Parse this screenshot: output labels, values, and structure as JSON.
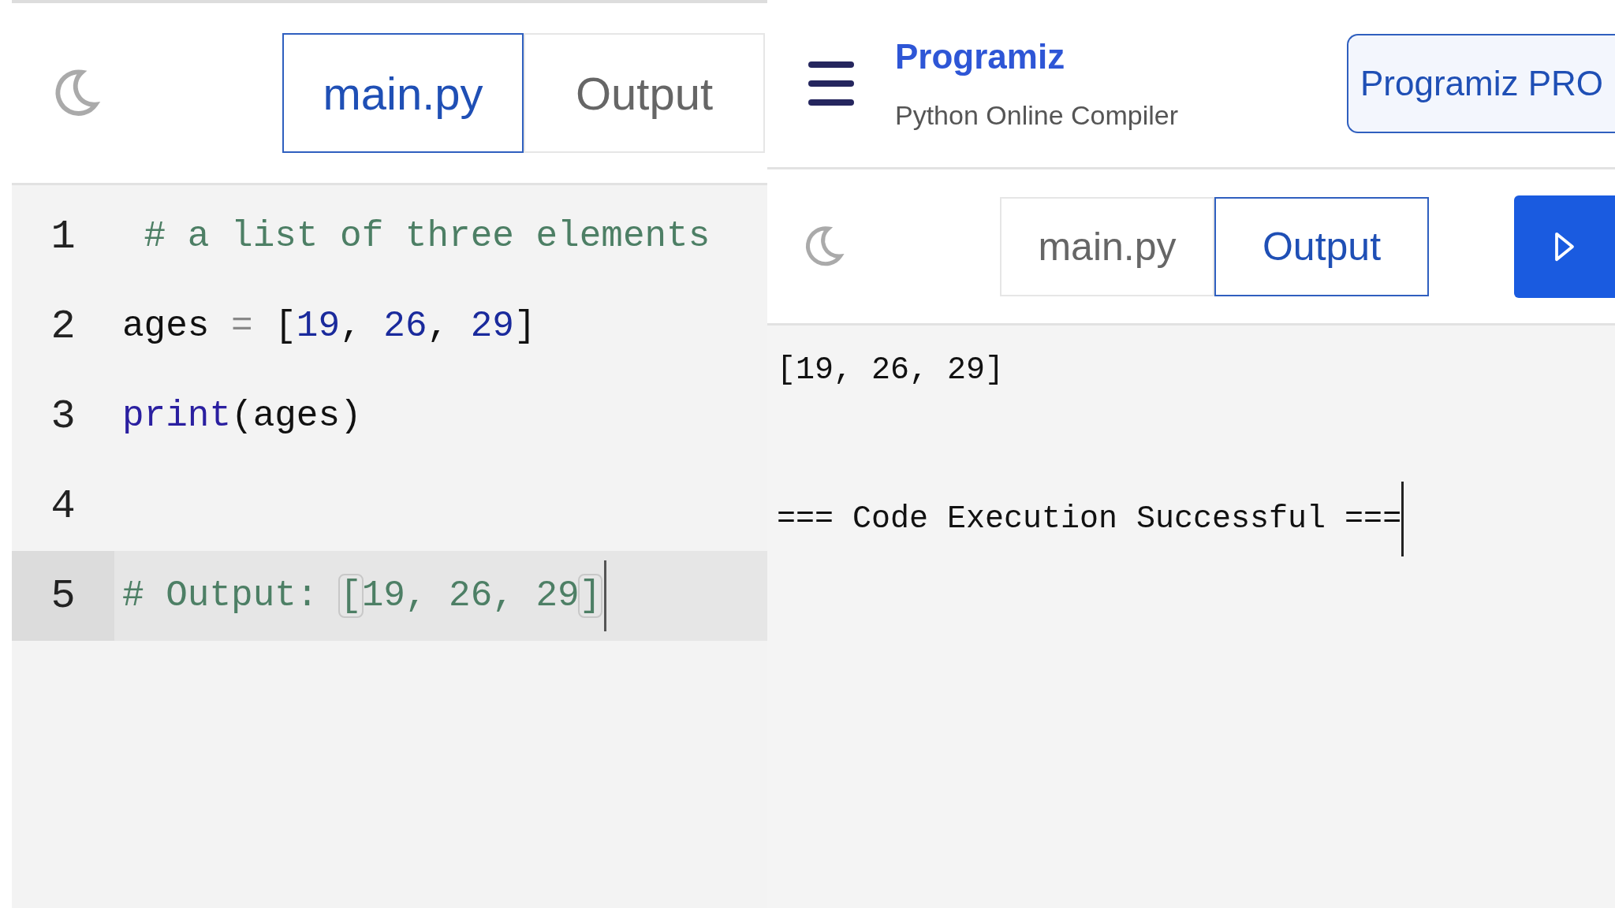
{
  "left_pane": {
    "tabs": [
      {
        "label": "main.py",
        "selected": true
      },
      {
        "label": "Output",
        "selected": false
      }
    ],
    "editor": {
      "lines": [
        {
          "number": "1",
          "highlighted": false,
          "tokens": [
            {
              "kind": "comment",
              "text": " # a list of three elements"
            }
          ]
        },
        {
          "number": "2",
          "highlighted": false,
          "tokens": [
            {
              "kind": "name",
              "text": "ages "
            },
            {
              "kind": "operator",
              "text": "="
            },
            {
              "kind": "name",
              "text": " ["
            },
            {
              "kind": "number",
              "text": "19"
            },
            {
              "kind": "name",
              "text": ", "
            },
            {
              "kind": "number",
              "text": "26"
            },
            {
              "kind": "name",
              "text": ", "
            },
            {
              "kind": "number",
              "text": "29"
            },
            {
              "kind": "name",
              "text": "]"
            }
          ]
        },
        {
          "number": "3",
          "highlighted": false,
          "tokens": [
            {
              "kind": "builtin",
              "text": "print"
            },
            {
              "kind": "name",
              "text": "(ages)"
            }
          ]
        },
        {
          "number": "4",
          "highlighted": false
        },
        {
          "number": "5",
          "highlighted": true,
          "tokens": [
            {
              "kind": "comment",
              "text": "# Output: "
            },
            {
              "kind": "matched",
              "text": "["
            },
            {
              "kind": "comment",
              "text": "19, 26, 29"
            },
            {
              "kind": "matched",
              "text": "]"
            }
          ]
        }
      ]
    }
  },
  "right_pane": {
    "header": {
      "brand": "Programiz",
      "subtitle": "Python Online Compiler",
      "pro_button": "Programiz PRO"
    },
    "tabs": [
      {
        "label": "main.py",
        "selected": false
      },
      {
        "label": "Output",
        "selected": true
      }
    ],
    "output": {
      "lines": [
        "[19, 26, 29]",
        "=== Code Execution Successful ==="
      ]
    }
  }
}
